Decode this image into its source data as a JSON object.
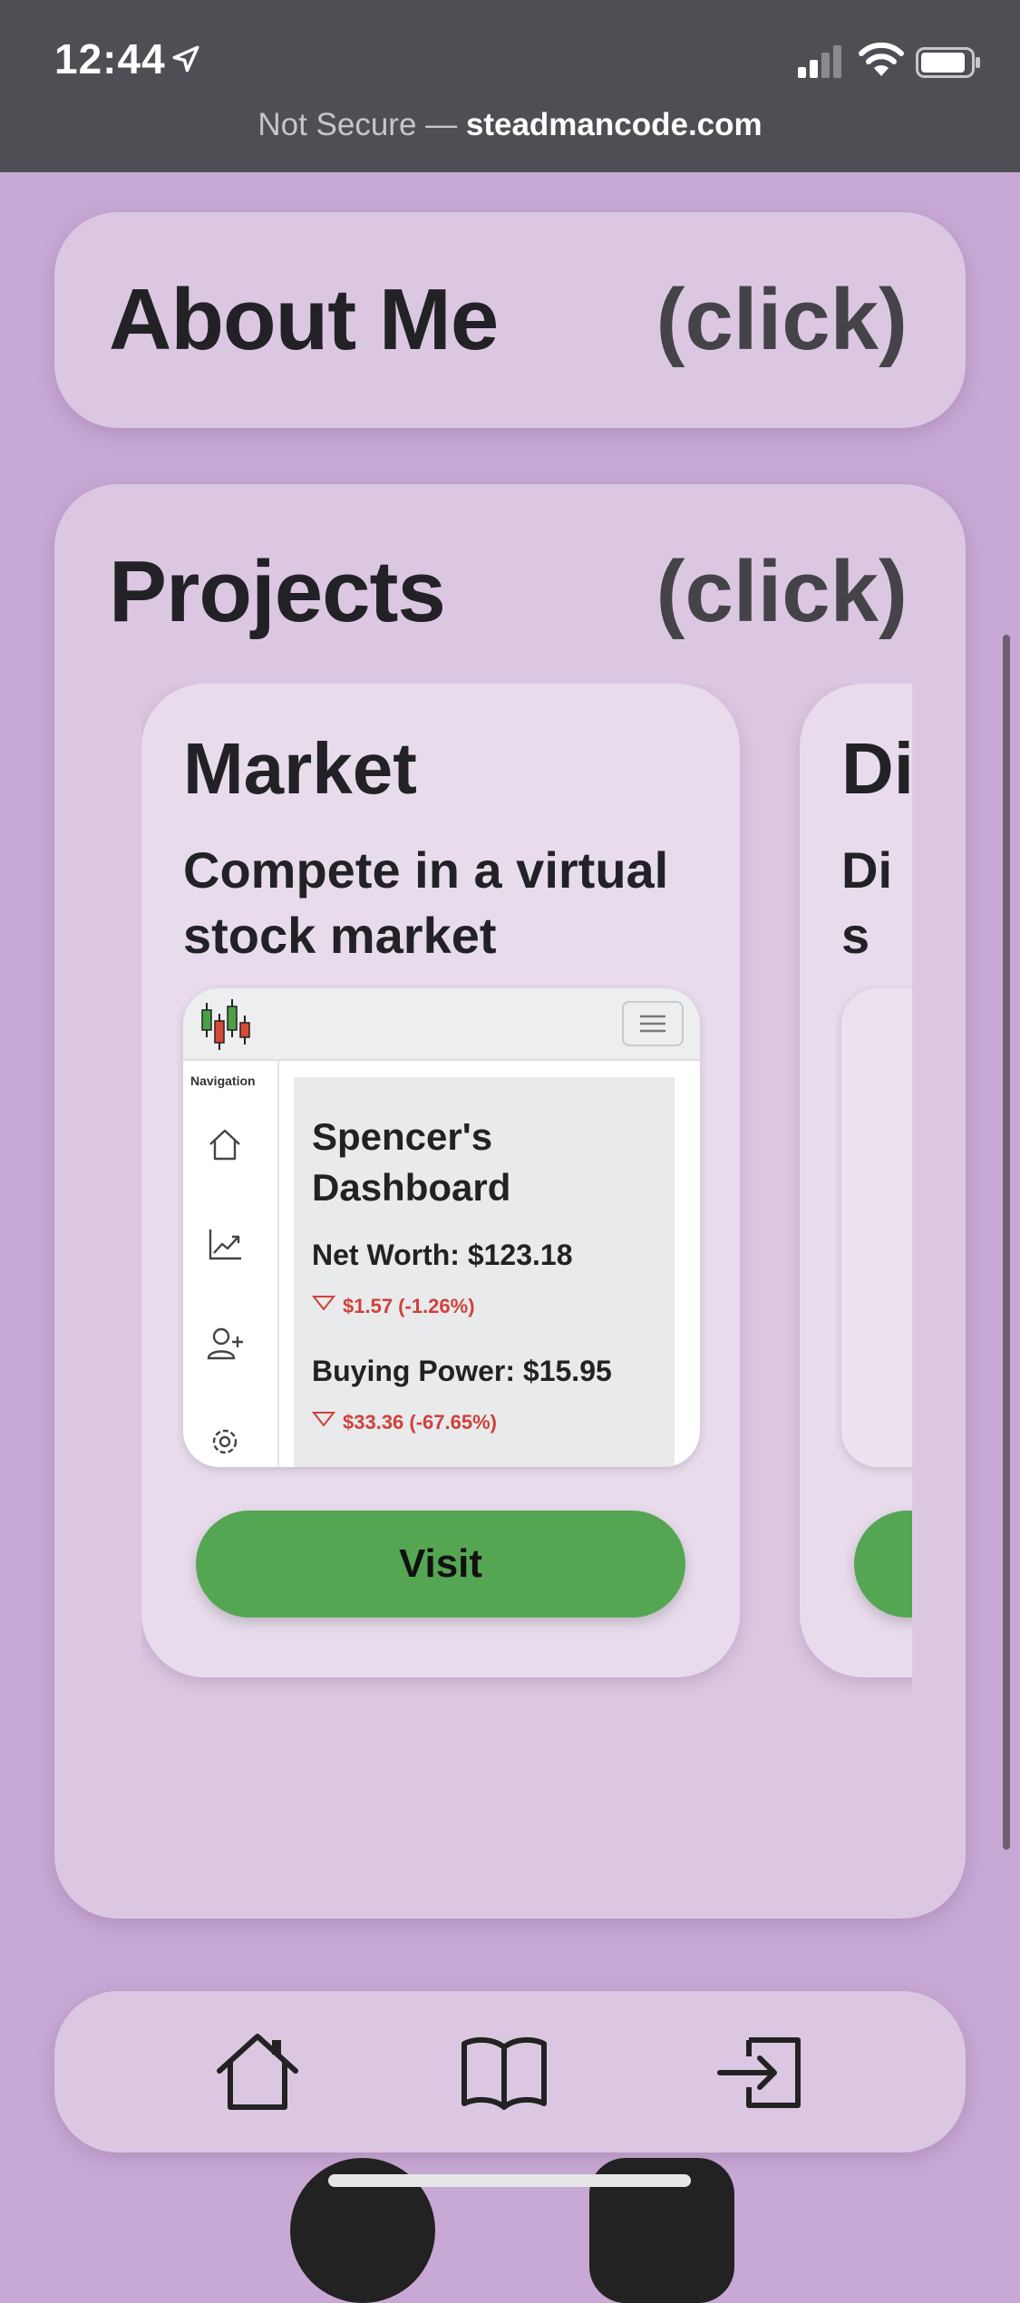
{
  "status_bar": {
    "time": "12:44",
    "url_prefix": "Not Secure — ",
    "url_domain": "steadmancode.com"
  },
  "about": {
    "title": "About Me",
    "click": "(click)"
  },
  "projects": {
    "title": "Projects",
    "click": "(click)",
    "items": [
      {
        "name": "Market",
        "description": "Compete in a virtual stock market",
        "visit_label": "Visit",
        "preview": {
          "nav_label": "Navigation",
          "dashboard_title": "Spencer's Dashboard",
          "net_worth": "Net Worth: $123.18",
          "net_worth_change": "$1.57 (-1.26%)",
          "buying_power": "Buying Power: $15.95",
          "buying_power_change": "$33.36 (-67.65%)"
        }
      },
      {
        "name": "Di",
        "description": "Dis co"
      }
    ]
  },
  "bottom_nav": {
    "items": [
      "home-icon",
      "book-icon",
      "login-icon"
    ]
  },
  "colors": {
    "background": "#c8a8d4",
    "card": "#dcc7e2",
    "visit_button": "#55a653",
    "negative_change": "#d0413a"
  }
}
